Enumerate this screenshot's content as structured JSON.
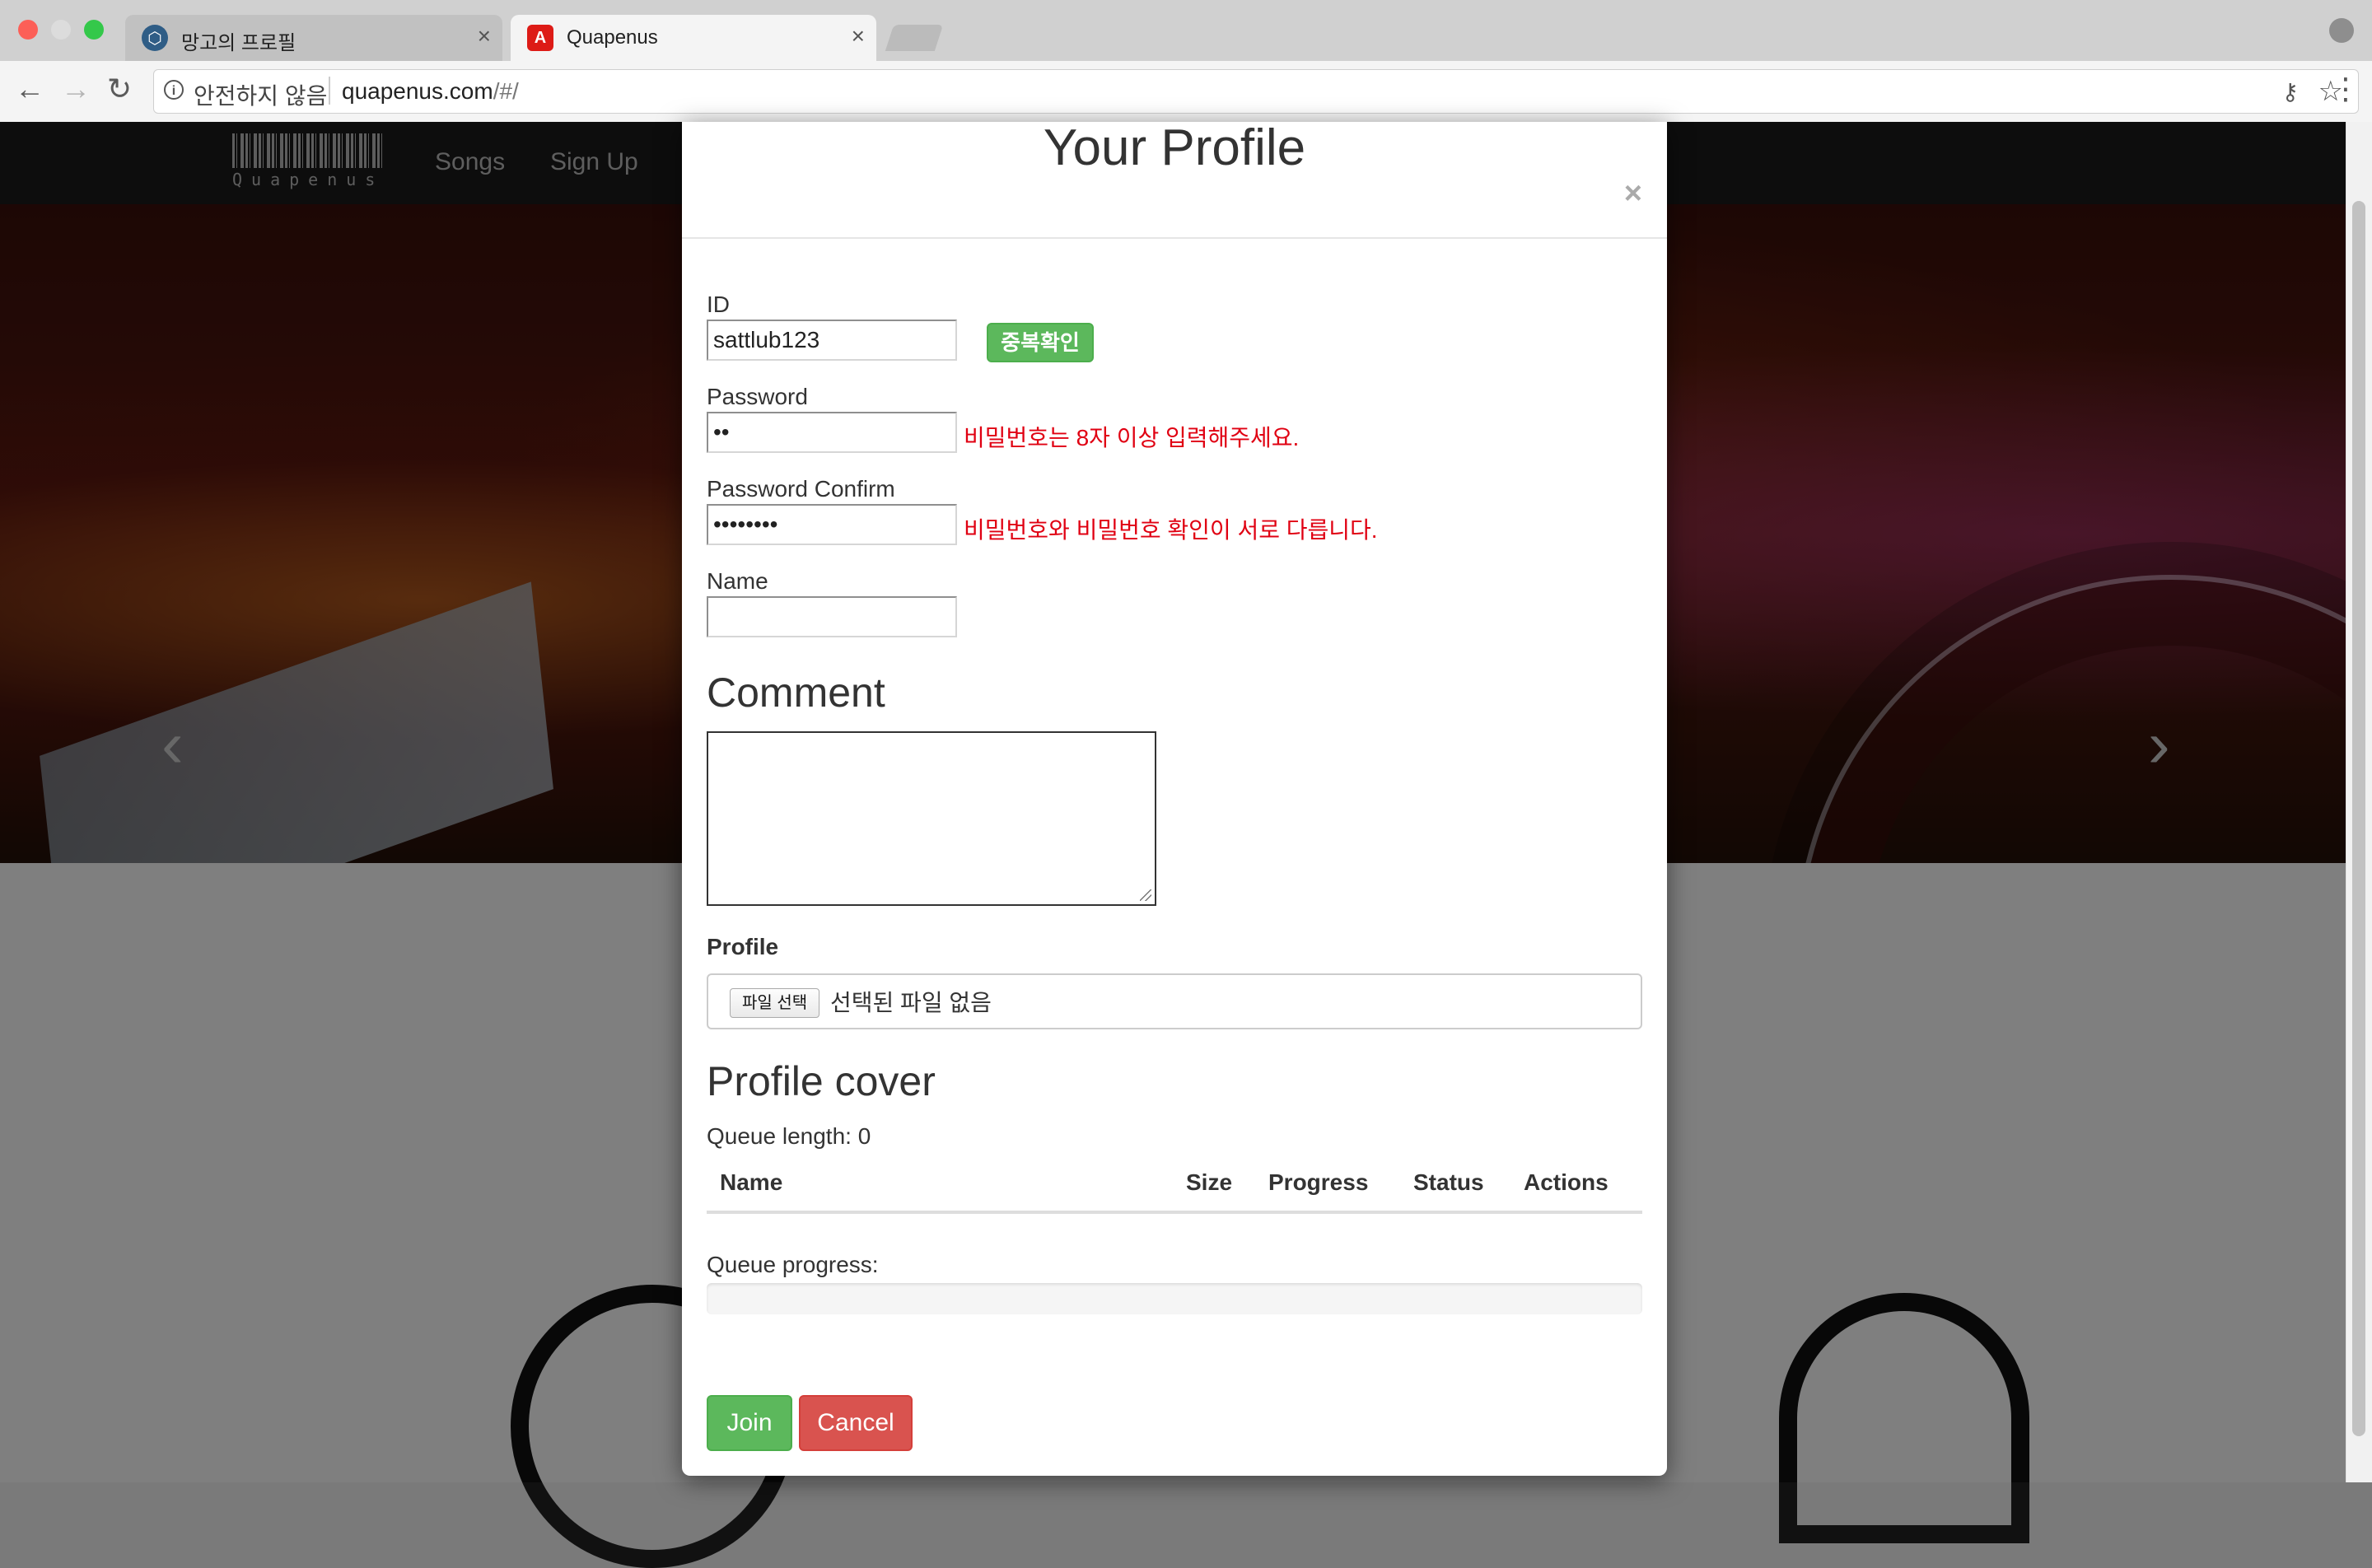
{
  "browser": {
    "tabs": [
      {
        "title": "망고의 프로필",
        "icon": "hexagon-icon"
      },
      {
        "title": "Quapenus",
        "icon": "angular-icon"
      }
    ],
    "security_label": "안전하지 않음",
    "url_host": "quapenus.com",
    "url_path": "/#/"
  },
  "site": {
    "logo_text": "Quapenus",
    "nav": [
      "Songs",
      "Sign Up"
    ]
  },
  "modal": {
    "title": "Your Profile",
    "close_label": "×",
    "id": {
      "label": "ID",
      "value": "sattlub123",
      "check_button": "중복확인"
    },
    "password": {
      "label": "Password",
      "value": "••",
      "error": "비밀번호는 8자 이상 입력해주세요."
    },
    "password_confirm": {
      "label": "Password Confirm",
      "value": "••••••••",
      "error": "비밀번호와 비밀번호 확인이 서로 다릅니다."
    },
    "name": {
      "label": "Name",
      "value": ""
    },
    "comment_heading": "Comment",
    "profile_label": "Profile",
    "file_button": "파일 선택",
    "file_status": "선택된 파일 없음",
    "cover_heading": "Profile cover",
    "queue_length": "Queue length: 0",
    "table_headers": [
      "Name",
      "Size",
      "Progress",
      "Status",
      "Actions"
    ],
    "queue_progress_label": "Queue progress:",
    "queue_progress": 0,
    "join_button": "Join",
    "cancel_button": "Cancel"
  },
  "colors": {
    "success": "#5cb85c",
    "danger": "#d9534f",
    "error_text": "#e00012"
  }
}
